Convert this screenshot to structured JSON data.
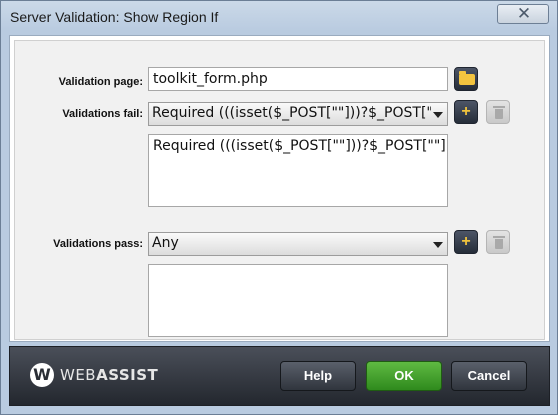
{
  "window": {
    "title": "Server Validation: Show Region If"
  },
  "form": {
    "validation_page_label": "Validation page:",
    "validation_page_value": "toolkit_form.php",
    "validations_fail_label": "Validations fail:",
    "validations_fail_selected": "Required (((isset($_POST[\"\"]))?$_POST[\"\"]:'",
    "validations_fail_list": [
      "Required (((isset($_POST[\"\"]))?$_POST[\"\"]:\"\"))"
    ],
    "validations_pass_label": "Validations pass:",
    "validations_pass_selected": "Any",
    "validations_pass_list": []
  },
  "footer": {
    "logo_letter": "W",
    "logo_text_1": "WEB",
    "logo_text_2": "ASSIST",
    "help_label": "Help",
    "ok_label": "OK",
    "cancel_label": "Cancel"
  },
  "icons": {
    "folder": "folder-icon",
    "plus": "plus-icon",
    "trash": "trash-icon",
    "close": "close-icon"
  },
  "colors": {
    "ok_button": "#3f9a2a",
    "dark_button": "#2f3540",
    "accent_plus": "#f0c33c"
  }
}
